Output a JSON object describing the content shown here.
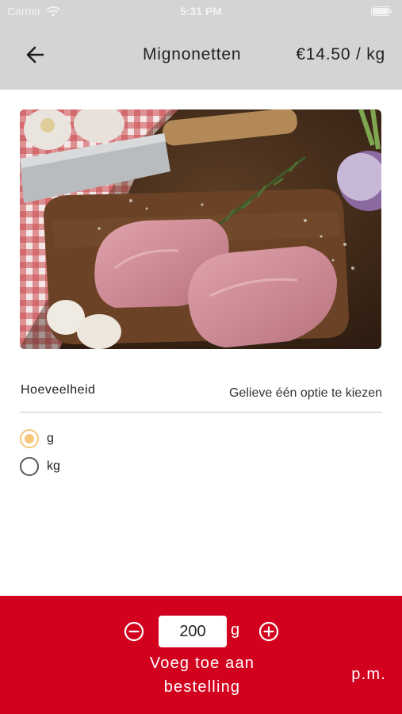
{
  "status_bar": {
    "carrier": "Carrier",
    "time": "5:31 PM"
  },
  "header": {
    "title": "Mignonetten",
    "price": "€14.50 / kg",
    "background_color": "#d4d4d4"
  },
  "product_image": {
    "alt": "Mignonetten"
  },
  "quantity": {
    "label": "Hoeveelheid",
    "hint": "Gelieve één optie te kiezen",
    "options": [
      {
        "label": "g",
        "selected": true
      },
      {
        "label": "kg",
        "selected": false
      }
    ],
    "selected_color": "#f6c77b"
  },
  "footer": {
    "amount": "200",
    "unit": "g",
    "add_label": "Voeg toe aan bestelling",
    "total": "p.m.",
    "background_color": "#d2011e"
  },
  "icons": {
    "back": "arrow-left-icon",
    "minus": "minus-circle-icon",
    "plus": "plus-circle-icon",
    "wifi": "wifi-icon",
    "battery": "battery-icon"
  }
}
